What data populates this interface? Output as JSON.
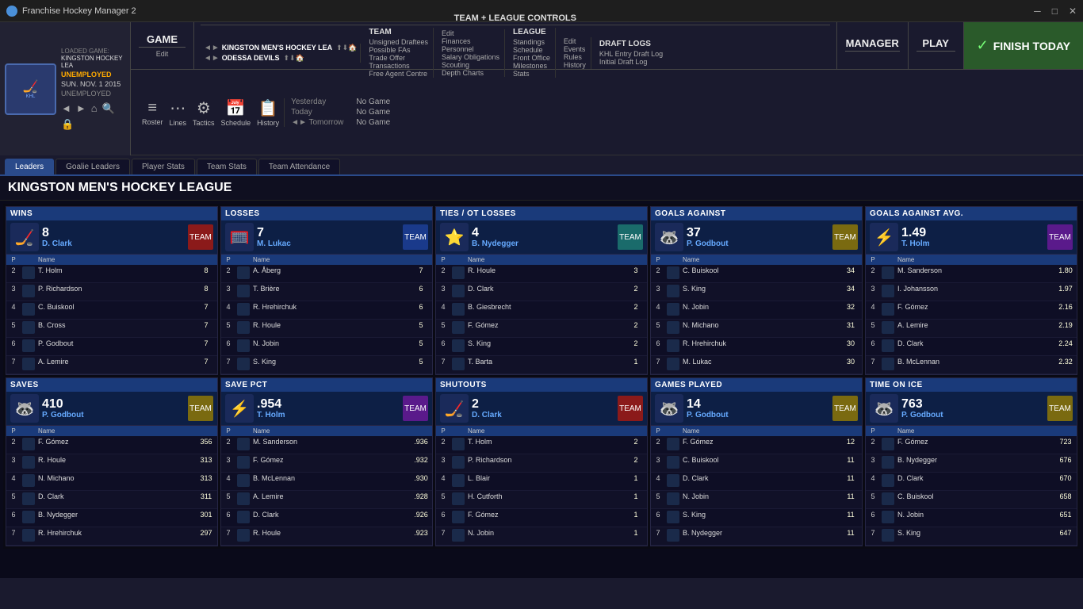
{
  "app": {
    "title": "Franchise Hockey Manager 2",
    "window_controls": [
      "minimize",
      "maximize",
      "close"
    ]
  },
  "header": {
    "loaded_game_label": "LOADED GAME:",
    "loaded_game_value": "KINGSTON HOCKEY LEA",
    "status1": "UNEMPLOYED",
    "date": "SUN. NOV. 1 2015",
    "status2": "UNEMPLOYED"
  },
  "nav": {
    "game_label": "GAME",
    "team_league_label": "TEAM + LEAGUE CONTROLS",
    "manager_label": "MANAGER",
    "play_label": "PLAY",
    "finish_label": "FINISH TODAY",
    "team_name1": "KINGSTON MEN'S HOCKEY LEA",
    "team_name2": "ODESSA DEVILS",
    "team_label": "TEAM",
    "league_label": "LEAGUE",
    "draft_logs_label": "DRAFT LOGS",
    "team_links": [
      "Unsigned Draftees",
      "Possible FAs",
      "Trade Offer",
      "Transactions",
      "Free Agent Centre"
    ],
    "team_edit_links": [
      "Edit",
      "Finances",
      "Personnel",
      "Salary Obligations",
      "Scouting",
      "Depth Charts"
    ],
    "league_links": [
      "Standings",
      "Schedule",
      "Front Office",
      "Milestones",
      "Stats"
    ],
    "league_edit_links": [
      "Edit",
      "Events",
      "Rules",
      "History"
    ],
    "draft_links": [
      "KHL Entry Draft Log",
      "Initial Draft Log"
    ],
    "roster_items": [
      "Roster",
      "Lines",
      "Tactics",
      "Schedule",
      "History"
    ]
  },
  "date_nav": {
    "yesterday_label": "Yesterday",
    "yesterday_value": "No Game",
    "today_label": "Today",
    "today_value": "No Game",
    "tomorrow_label": "◄► Tomorrow",
    "tomorrow_value": "No Game"
  },
  "sub_tabs": [
    "Leaders",
    "Goalie Leaders",
    "Player Stats",
    "Team Stats",
    "Team Attendance"
  ],
  "active_tab": "Leaders",
  "page_title": "KINGSTON MEN'S HOCKEY LEAGUE",
  "stats": {
    "wins": {
      "title": "WINS",
      "leader_num": "8",
      "leader_name": "D. Clark",
      "rows": [
        {
          "pos": "2",
          "name": "T. Holm",
          "value": "8"
        },
        {
          "pos": "3",
          "name": "P. Richardson",
          "value": "8"
        },
        {
          "pos": "4",
          "name": "C. Buiskool",
          "value": "7"
        },
        {
          "pos": "5",
          "name": "B. Cross",
          "value": "7"
        },
        {
          "pos": "6",
          "name": "P. Godbout",
          "value": "7"
        },
        {
          "pos": "7",
          "name": "A. Lemire",
          "value": "7"
        }
      ]
    },
    "losses": {
      "title": "LOSSES",
      "leader_num": "7",
      "leader_name": "M. Lukac",
      "rows": [
        {
          "pos": "2",
          "name": "A. Åberg",
          "value": "7"
        },
        {
          "pos": "3",
          "name": "T. Brière",
          "value": "6"
        },
        {
          "pos": "4",
          "name": "R. Hrehirchuk",
          "value": "6"
        },
        {
          "pos": "5",
          "name": "R. Houle",
          "value": "5"
        },
        {
          "pos": "6",
          "name": "N. Jobin",
          "value": "5"
        },
        {
          "pos": "7",
          "name": "S. King",
          "value": "5"
        }
      ]
    },
    "ties": {
      "title": "TIES / OT LOSSES",
      "leader_num": "4",
      "leader_name": "B. Nydegger",
      "rows": [
        {
          "pos": "2",
          "name": "R. Houle",
          "value": "3"
        },
        {
          "pos": "3",
          "name": "D. Clark",
          "value": "2"
        },
        {
          "pos": "4",
          "name": "B. Giesbrecht",
          "value": "2"
        },
        {
          "pos": "5",
          "name": "F. Gómez",
          "value": "2"
        },
        {
          "pos": "6",
          "name": "S. King",
          "value": "2"
        },
        {
          "pos": "7",
          "name": "T. Barta",
          "value": "1"
        }
      ]
    },
    "goals_against": {
      "title": "GOALS AGAINST",
      "leader_num": "37",
      "leader_name": "P. Godbout",
      "rows": [
        {
          "pos": "2",
          "name": "C. Buiskool",
          "value": "34"
        },
        {
          "pos": "3",
          "name": "S. King",
          "value": "34"
        },
        {
          "pos": "4",
          "name": "N. Jobin",
          "value": "32"
        },
        {
          "pos": "5",
          "name": "N. Michano",
          "value": "31"
        },
        {
          "pos": "6",
          "name": "R. Hrehirchuk",
          "value": "30"
        },
        {
          "pos": "7",
          "name": "M. Lukac",
          "value": "30"
        }
      ]
    },
    "goals_against_avg": {
      "title": "GOALS AGAINST AVG.",
      "leader_num": "1.49",
      "leader_name": "T. Holm",
      "rows": [
        {
          "pos": "2",
          "name": "M. Sanderson",
          "value": "1.80"
        },
        {
          "pos": "3",
          "name": "I. Johansson",
          "value": "1.97"
        },
        {
          "pos": "4",
          "name": "F. Gómez",
          "value": "2.16"
        },
        {
          "pos": "5",
          "name": "A. Lemire",
          "value": "2.19"
        },
        {
          "pos": "6",
          "name": "D. Clark",
          "value": "2.24"
        },
        {
          "pos": "7",
          "name": "B. McLennan",
          "value": "2.32"
        }
      ]
    },
    "saves": {
      "title": "SAVES",
      "leader_num": "410",
      "leader_name": "P. Godbout",
      "rows": [
        {
          "pos": "2",
          "name": "F. Gómez",
          "value": "356"
        },
        {
          "pos": "3",
          "name": "R. Houle",
          "value": "313"
        },
        {
          "pos": "4",
          "name": "N. Michano",
          "value": "313"
        },
        {
          "pos": "5",
          "name": "D. Clark",
          "value": "311"
        },
        {
          "pos": "6",
          "name": "B. Nydegger",
          "value": "301"
        },
        {
          "pos": "7",
          "name": "R. Hrehirchuk",
          "value": "297"
        }
      ]
    },
    "save_pct": {
      "title": "SAVE PCT",
      "leader_num": ".954",
      "leader_name": "T. Holm",
      "rows": [
        {
          "pos": "2",
          "name": "M. Sanderson",
          "value": ".936"
        },
        {
          "pos": "3",
          "name": "F. Gómez",
          "value": ".932"
        },
        {
          "pos": "4",
          "name": "B. McLennan",
          "value": ".930"
        },
        {
          "pos": "5",
          "name": "A. Lemire",
          "value": ".928"
        },
        {
          "pos": "6",
          "name": "D. Clark",
          "value": ".926"
        },
        {
          "pos": "7",
          "name": "R. Houle",
          "value": ".923"
        }
      ]
    },
    "shutouts": {
      "title": "SHUTOUTS",
      "leader_num": "2",
      "leader_name": "D. Clark",
      "rows": [
        {
          "pos": "2",
          "name": "T. Holm",
          "value": "2"
        },
        {
          "pos": "3",
          "name": "P. Richardson",
          "value": "2"
        },
        {
          "pos": "4",
          "name": "L. Blair",
          "value": "1"
        },
        {
          "pos": "5",
          "name": "H. Cutforth",
          "value": "1"
        },
        {
          "pos": "6",
          "name": "F. Gómez",
          "value": "1"
        },
        {
          "pos": "7",
          "name": "N. Jobin",
          "value": "1"
        }
      ]
    },
    "games_played": {
      "title": "GAMES PLAYED",
      "leader_num": "14",
      "leader_name": "P. Godbout",
      "rows": [
        {
          "pos": "2",
          "name": "F. Gómez",
          "value": "12"
        },
        {
          "pos": "3",
          "name": "C. Buiskool",
          "value": "11"
        },
        {
          "pos": "4",
          "name": "D. Clark",
          "value": "11"
        },
        {
          "pos": "5",
          "name": "N. Jobin",
          "value": "11"
        },
        {
          "pos": "6",
          "name": "S. King",
          "value": "11"
        },
        {
          "pos": "7",
          "name": "B. Nydegger",
          "value": "11"
        }
      ]
    },
    "time_on_ice": {
      "title": "TIME ON ICE",
      "leader_num": "763",
      "leader_name": "P. Godbout",
      "rows": [
        {
          "pos": "2",
          "name": "F. Gómez",
          "value": "723"
        },
        {
          "pos": "3",
          "name": "B. Nydegger",
          "value": "676"
        },
        {
          "pos": "4",
          "name": "D. Clark",
          "value": "670"
        },
        {
          "pos": "5",
          "name": "C. Buiskool",
          "value": "658"
        },
        {
          "pos": "6",
          "name": "N. Jobin",
          "value": "651"
        },
        {
          "pos": "7",
          "name": "S. King",
          "value": "647"
        }
      ]
    }
  },
  "team_logos": {
    "clark": "red",
    "lukac": "blue",
    "nydegger": "teal",
    "godbout": "gold",
    "holm": "purple"
  }
}
